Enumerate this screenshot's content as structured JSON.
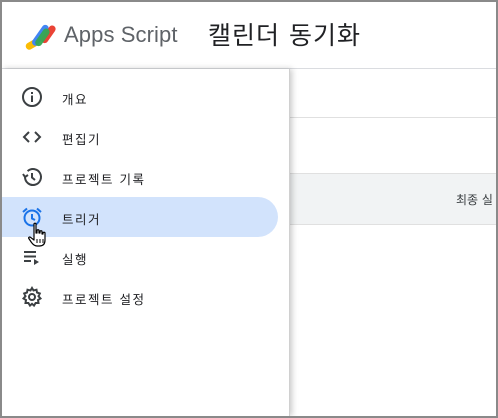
{
  "header": {
    "app_name": "Apps Script",
    "project_title": "캘린더 동기화"
  },
  "sidebar": {
    "items": [
      {
        "label": "개요",
        "icon": "info-icon",
        "active": false
      },
      {
        "label": "편집기",
        "icon": "code-icon",
        "active": false
      },
      {
        "label": "프로젝트 기록",
        "icon": "history-icon",
        "active": false
      },
      {
        "label": "트리거",
        "icon": "alarm-clock-icon",
        "active": true
      },
      {
        "label": "실행",
        "icon": "executions-list-icon",
        "active": false
      },
      {
        "label": "프로젝트 설정",
        "icon": "gear-icon",
        "active": false
      }
    ]
  },
  "main": {
    "table": {
      "columns": [
        "최종 실"
      ]
    }
  },
  "colors": {
    "active_bg": "#d2e3fc",
    "active_icon": "#1a73e8",
    "icon": "#5f6368",
    "text": "#202124"
  }
}
